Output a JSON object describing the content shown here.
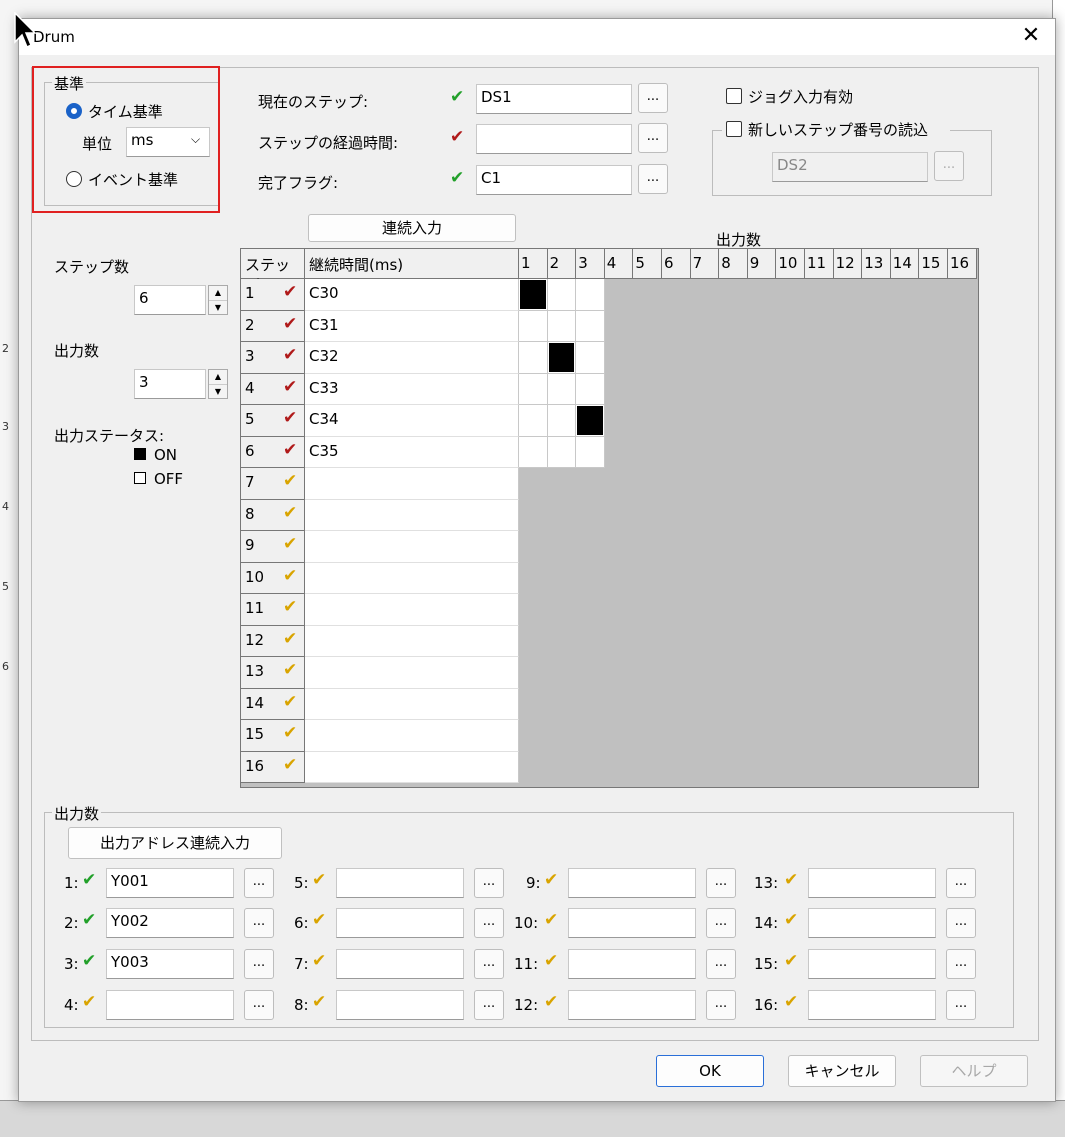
{
  "dialog": {
    "title": "Drum",
    "close_glyph": "✕"
  },
  "basis": {
    "legend": "基準",
    "time_label": "タイム基準",
    "unit_label": "単位",
    "unit_value": "ms",
    "event_label": "イベント基準"
  },
  "fields": {
    "current_step_label": "現在のステップ:",
    "current_step_value": "DS1",
    "elapsed_label": "ステップの経過時間:",
    "elapsed_value": "",
    "done_flag_label": "完了フラグ:",
    "done_flag_value": "C1",
    "dots": "..."
  },
  "options": {
    "jog_label": "ジョグ入力有効",
    "new_step_label": "新しいステップ番号の読込",
    "new_step_value": "DS2"
  },
  "left": {
    "steps_label": "ステップ数",
    "steps_value": "6",
    "outputs_label": "出力数",
    "outputs_value": "3",
    "status_label": "出力ステータス:",
    "on_label": "ON",
    "off_label": "OFF"
  },
  "table": {
    "continuous_button": "連続入力",
    "outputs_header": "出力数",
    "step_header": "ステップ",
    "duration_header": "継続時間(ms)",
    "output_columns": [
      "1",
      "2",
      "3",
      "4",
      "5",
      "6",
      "7",
      "8",
      "9",
      "10",
      "11",
      "12",
      "13",
      "14",
      "15",
      "16"
    ],
    "rows": [
      {
        "step": "1",
        "status": "red",
        "duration": "C30",
        "on": [
          1
        ]
      },
      {
        "step": "2",
        "status": "red",
        "duration": "C31",
        "on": []
      },
      {
        "step": "3",
        "status": "red",
        "duration": "C32",
        "on": [
          2
        ]
      },
      {
        "step": "4",
        "status": "red",
        "duration": "C33",
        "on": []
      },
      {
        "step": "5",
        "status": "red",
        "duration": "C34",
        "on": [
          3
        ]
      },
      {
        "step": "6",
        "status": "red",
        "duration": "C35",
        "on": []
      },
      {
        "step": "7",
        "status": "yellow",
        "duration": "",
        "on": []
      },
      {
        "step": "8",
        "status": "yellow",
        "duration": "",
        "on": []
      },
      {
        "step": "9",
        "status": "yellow",
        "duration": "",
        "on": []
      },
      {
        "step": "10",
        "status": "yellow",
        "duration": "",
        "on": []
      },
      {
        "step": "11",
        "status": "yellow",
        "duration": "",
        "on": []
      },
      {
        "step": "12",
        "status": "yellow",
        "duration": "",
        "on": []
      },
      {
        "step": "13",
        "status": "yellow",
        "duration": "",
        "on": []
      },
      {
        "step": "14",
        "status": "yellow",
        "duration": "",
        "on": []
      },
      {
        "step": "15",
        "status": "yellow",
        "duration": "",
        "on": []
      },
      {
        "step": "16",
        "status": "yellow",
        "duration": "",
        "on": []
      }
    ]
  },
  "outputs": {
    "legend": "出力数",
    "address_button": "出力アドレス連続入力",
    "items": [
      {
        "label": "1:",
        "status": "green",
        "value": "Y001"
      },
      {
        "label": "2:",
        "status": "green",
        "value": "Y002"
      },
      {
        "label": "3:",
        "status": "green",
        "value": "Y003"
      },
      {
        "label": "4:",
        "status": "yellow",
        "value": ""
      },
      {
        "label": "5:",
        "status": "yellow",
        "value": ""
      },
      {
        "label": "6:",
        "status": "yellow",
        "value": ""
      },
      {
        "label": "7:",
        "status": "yellow",
        "value": ""
      },
      {
        "label": "8:",
        "status": "yellow",
        "value": ""
      },
      {
        "label": "9:",
        "status": "yellow",
        "value": ""
      },
      {
        "label": "10:",
        "status": "yellow",
        "value": ""
      },
      {
        "label": "11:",
        "status": "yellow",
        "value": ""
      },
      {
        "label": "12:",
        "status": "yellow",
        "value": ""
      },
      {
        "label": "13:",
        "status": "yellow",
        "value": ""
      },
      {
        "label": "14:",
        "status": "yellow",
        "value": ""
      },
      {
        "label": "15:",
        "status": "yellow",
        "value": ""
      },
      {
        "label": "16:",
        "status": "yellow",
        "value": ""
      }
    ]
  },
  "buttons": {
    "ok": "OK",
    "cancel": "キャンセル",
    "help": "ヘルプ"
  },
  "colors": {
    "check_green": "#22a02a",
    "check_red": "#b01a1a",
    "check_yellow": "#d9a400",
    "highlight": "#e02020",
    "grid_disabled": "#c0c0c0"
  }
}
